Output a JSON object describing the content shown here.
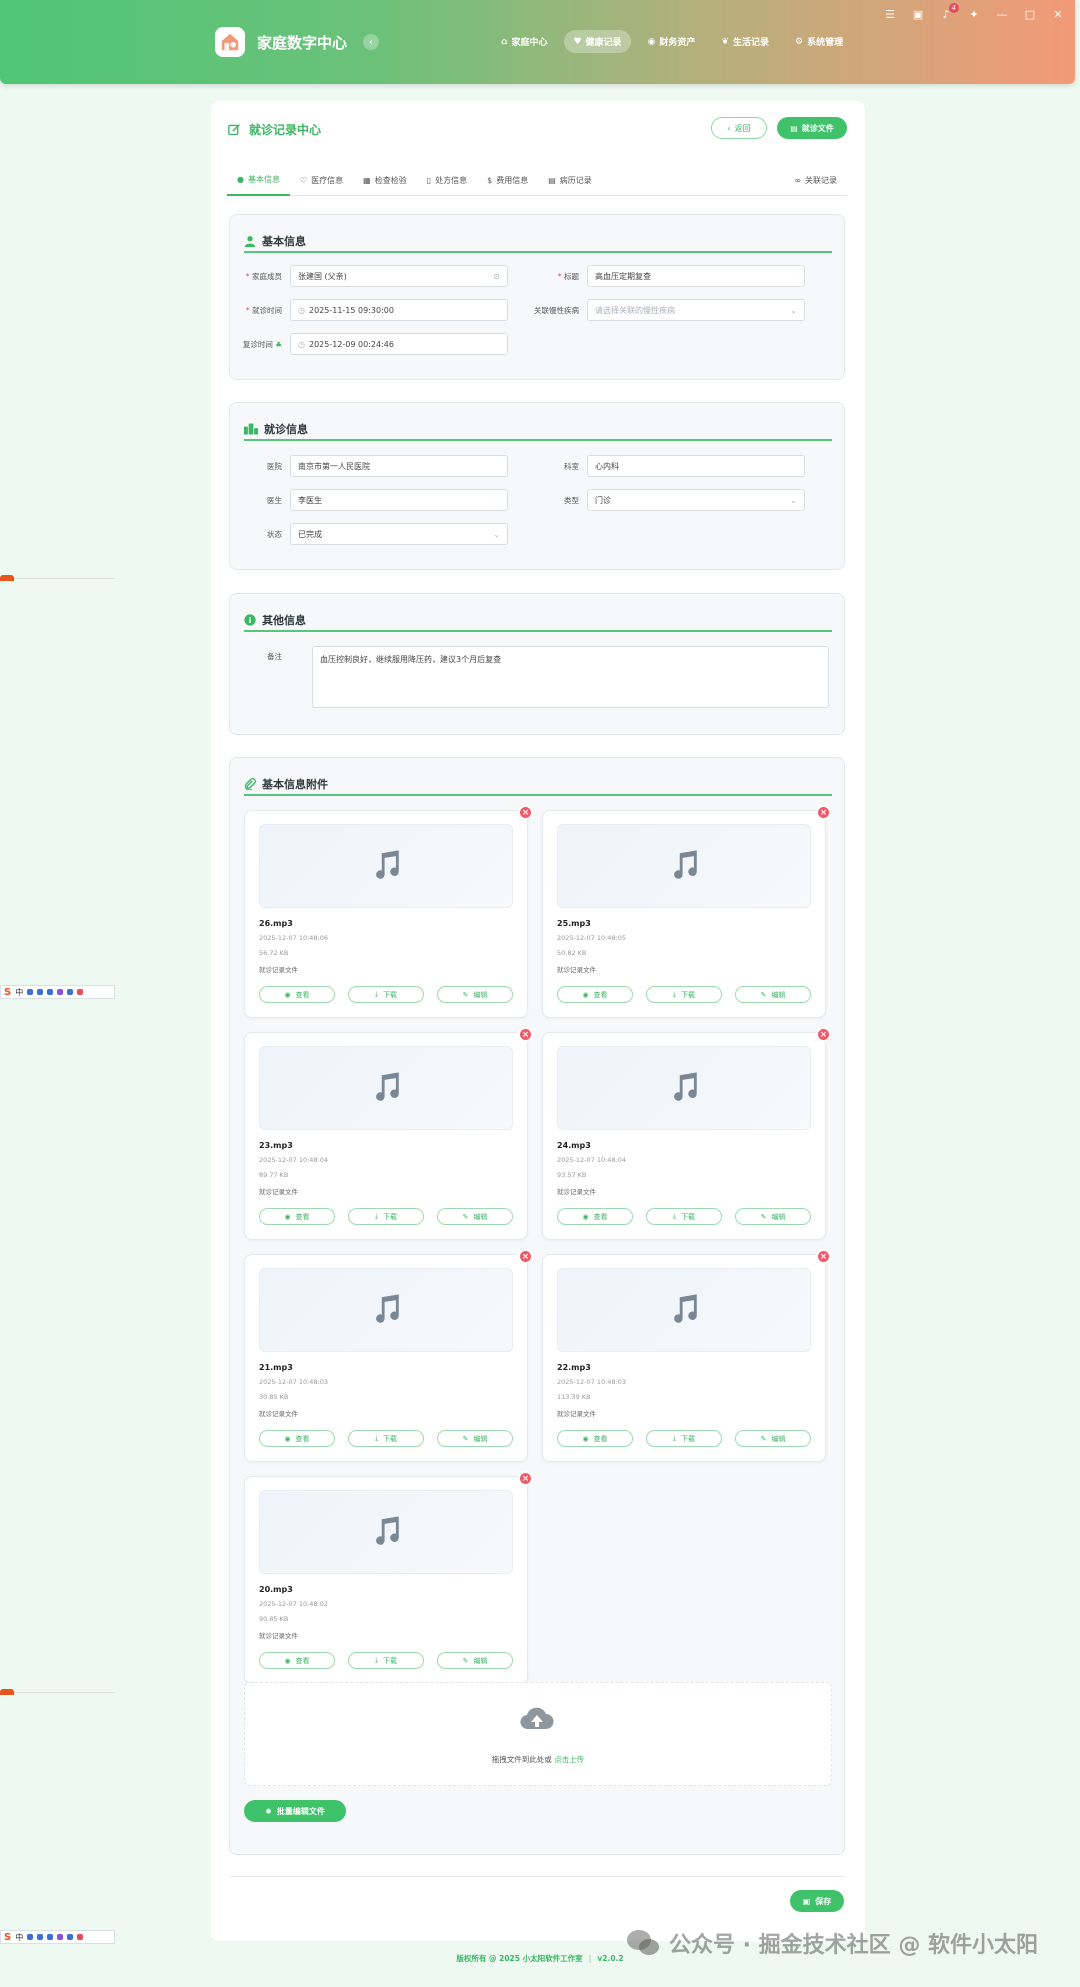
{
  "app": {
    "title": "家庭数字中心"
  },
  "nav": [
    {
      "label": "家庭中心",
      "icon": "home-icon"
    },
    {
      "label": "健康记录",
      "icon": "heart-icon",
      "active": true
    },
    {
      "label": "财务资产",
      "icon": "coins-icon"
    },
    {
      "label": "生活记录",
      "icon": "leaf-icon"
    },
    {
      "label": "系统管理",
      "icon": "gears-icon"
    }
  ],
  "window": {
    "notification_count": "4"
  },
  "page": {
    "title": "就诊记录中心",
    "back_label": "返回",
    "files_label": "就诊文件"
  },
  "tabs": [
    {
      "label": "基本信息",
      "active": true
    },
    {
      "label": "医疗信息"
    },
    {
      "label": "检查检验"
    },
    {
      "label": "处方信息"
    },
    {
      "label": "费用信息"
    },
    {
      "label": "病历记录"
    },
    {
      "label": "关联记录"
    }
  ],
  "basic": {
    "title": "基本信息",
    "member_label": "家庭成员",
    "member_value": "张建国 (父亲)",
    "title_label": "标题",
    "title_value": "高血压定期复查",
    "visit_time_label": "就诊时间",
    "visit_time_value": "2025-11-15 09:30:00",
    "chronic_label": "关联慢性疾病",
    "chronic_placeholder": "请选择关联的慢性疾病",
    "followup_label": "复诊时间",
    "followup_value": "2025-12-09 00:24:46"
  },
  "visit": {
    "title": "就诊信息",
    "hospital_label": "医院",
    "hospital_value": "南京市第一人民医院",
    "dept_label": "科室",
    "dept_value": "心内科",
    "doctor_label": "医生",
    "doctor_value": "李医生",
    "type_label": "类型",
    "type_value": "门诊",
    "status_label": "状态",
    "status_value": "已完成"
  },
  "other": {
    "title": "其他信息",
    "note_label": "备注",
    "note_value": "血压控制良好，继续服用降压药，建议3个月后复查"
  },
  "attachments": {
    "title": "基本信息附件",
    "view_label": "查看",
    "download_label": "下载",
    "edit_label": "编辑",
    "items": [
      {
        "name": "26.mp3",
        "time": "2025-12-07 10:48:06",
        "size": "56.72 KB",
        "desc": "就诊记录文件"
      },
      {
        "name": "25.mp3",
        "time": "2025-12-07 10:48:05",
        "size": "50.82 KB",
        "desc": "就诊记录文件"
      },
      {
        "name": "23.mp3",
        "time": "2025-12-07 10:48:04",
        "size": "89.77 KB",
        "desc": "就诊记录文件"
      },
      {
        "name": "24.mp3",
        "time": "2025-12-07 10:48:04",
        "size": "93.57 KB",
        "desc": "就诊记录文件"
      },
      {
        "name": "21.mp3",
        "time": "2025-12-07 10:48:03",
        "size": "30.85 KB",
        "desc": "就诊记录文件"
      },
      {
        "name": "22.mp3",
        "time": "2025-12-07 10:48:03",
        "size": "113.39 KB",
        "desc": "就诊记录文件"
      },
      {
        "name": "20.mp3",
        "time": "2025-12-07 10:48:02",
        "size": "90.85 KB",
        "desc": "就诊记录文件"
      }
    ],
    "upload_text": "拖拽文件到此处或",
    "upload_link": "点击上传",
    "batch_label": "批量编辑文件"
  },
  "save_label": "保存",
  "footer": {
    "copyright": "版权所有 @ 2025 小太阳软件工作室",
    "version": "v2.0.2"
  },
  "ime": {
    "lang": "中"
  },
  "watermark": {
    "text": "公众号 · 掘金技术社区 @ 软件小太阳"
  },
  "colors": {
    "accent": "#40c26b",
    "danger": "#ec5a6b",
    "header_start": "#4fc676",
    "header_end": "#f39a78"
  }
}
